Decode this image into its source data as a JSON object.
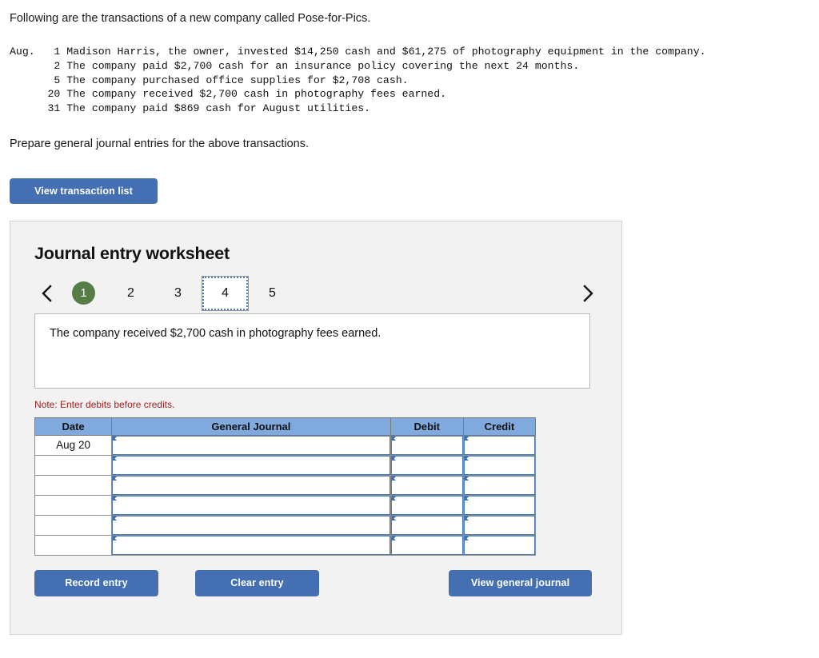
{
  "intro": {
    "heading": "Following are the transactions of a new company called Pose-for-Pics.",
    "prepare": "Prepare general journal entries for the above transactions.",
    "transactions_text": "Aug.   1 Madison Harris, the owner, invested $14,250 cash and $61,275 of photography equipment in the company.\n       2 The company paid $2,700 cash for an insurance policy covering the next 24 months.\n       5 The company purchased office supplies for $2,708 cash.\n      20 The company received $2,700 cash in photography fees earned.\n      31 The company paid $869 cash for August utilities.",
    "transactions": [
      {
        "month": "Aug.",
        "day": "1",
        "text": "Madison Harris, the owner, invested $14,250 cash and $61,275 of photography equipment in the company."
      },
      {
        "month": "",
        "day": "2",
        "text": "The company paid $2,700 cash for an insurance policy covering the next 24 months."
      },
      {
        "month": "",
        "day": "5",
        "text": "The company purchased office supplies for $2,708 cash."
      },
      {
        "month": "",
        "day": "20",
        "text": "The company received $2,700 cash in photography fees earned."
      },
      {
        "month": "",
        "day": "31",
        "text": "The company paid $869 cash for August utilities."
      }
    ]
  },
  "toolbar": {
    "view_transaction_list_label": "View transaction list"
  },
  "worksheet": {
    "title": "Journal entry worksheet",
    "prev_arrow_icon": "chevron-left-icon",
    "next_arrow_icon": "chevron-right-icon",
    "pages": [
      {
        "label": "1",
        "state": "completed"
      },
      {
        "label": "2",
        "state": "default"
      },
      {
        "label": "3",
        "state": "default"
      },
      {
        "label": "4",
        "state": "current"
      },
      {
        "label": "5",
        "state": "default"
      }
    ],
    "description": "The company received $2,700 cash in photography fees earned.",
    "note": "Note: Enter debits before credits.",
    "table": {
      "headers": [
        "Date",
        "General Journal",
        "Debit",
        "Credit"
      ],
      "rows": [
        {
          "date": "Aug 20",
          "account": "",
          "debit": "",
          "credit": ""
        },
        {
          "date": "",
          "account": "",
          "debit": "",
          "credit": ""
        },
        {
          "date": "",
          "account": "",
          "debit": "",
          "credit": ""
        },
        {
          "date": "",
          "account": "",
          "debit": "",
          "credit": ""
        },
        {
          "date": "",
          "account": "",
          "debit": "",
          "credit": ""
        },
        {
          "date": "",
          "account": "",
          "debit": "",
          "credit": ""
        }
      ]
    },
    "buttons": {
      "record_entry": "Record entry",
      "clear_entry": "Clear entry",
      "view_general_journal": "View general journal"
    }
  },
  "colors": {
    "button_blue": "#4470b3",
    "table_header_blue": "#80a9dd",
    "input_border_blue": "#4a7ebb",
    "completed_green": "#567d46",
    "note_red": "#a32020",
    "panel_bg": "#f2f2f2",
    "panel_border": "#d3d3d3"
  }
}
